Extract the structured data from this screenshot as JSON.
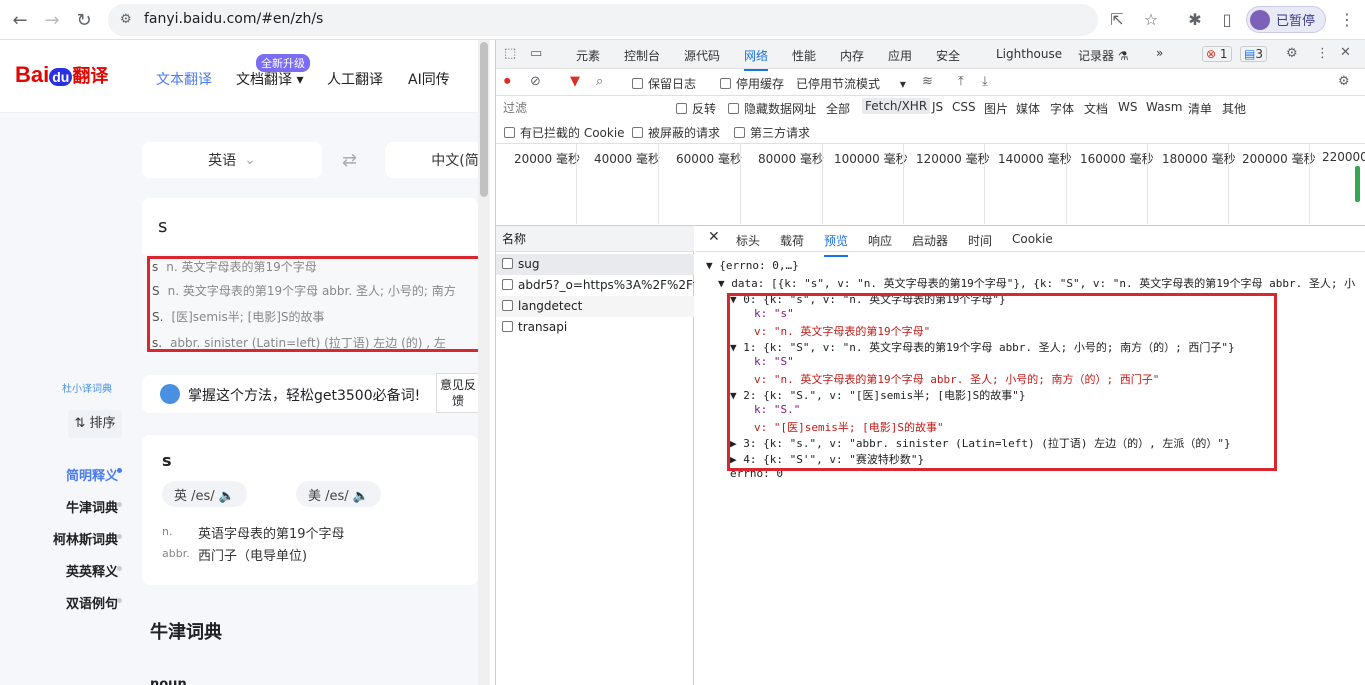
{
  "browser": {
    "url": "fanyi.baidu.com/#en/zh/s",
    "profile_label": "已暂停"
  },
  "site": {
    "logo_bai": "Bai",
    "logo_du": "du",
    "logo_fanyi": "翻译",
    "nav": [
      "文本翻译",
      "文档翻译 ▾",
      "人工翻译",
      "AI同传"
    ],
    "badge": "全新升级",
    "source_lang": "英语",
    "target_lang": "中文(简",
    "input_text": "s",
    "suggestions": [
      {
        "k": "s",
        "v": "n. 英文字母表的第19个字母"
      },
      {
        "k": "S",
        "v": "n. 英文字母表的第19个字母 abbr. 圣人; 小号的; 南方"
      },
      {
        "k": "S.",
        "v": "[医]semis半; [电影]S的故事"
      },
      {
        "k": "s.",
        "v": "abbr. sinister (Latin=left) (拉丁语) 左边 (的) , 左"
      }
    ],
    "tip_text": "掌握这个方法，轻松get3500必备词!",
    "tip_btn": "意见反馈",
    "dict_label": "杜小译词典",
    "sort_label": "⇅ 排序",
    "sidenav": [
      "简明释义",
      "牛津词典",
      "柯林斯词典",
      "英英释义",
      "双语例句"
    ],
    "result": {
      "word": "s",
      "pron_uk": "英 /es/ 🔈",
      "pron_us": "美 /es/ 🔈",
      "defs": [
        {
          "pos": "n.",
          "text": "英语字母表的第19个字母"
        },
        {
          "pos": "abbr.",
          "text": "西门子（电导单位)"
        }
      ]
    },
    "oxford_title": "牛津词典",
    "noun_label": "noun"
  },
  "devtools": {
    "tabs": [
      "元素",
      "控制台",
      "源代码",
      "网络",
      "性能",
      "内存",
      "应用",
      "安全",
      "Lighthouse",
      "记录器 ⚗",
      "»"
    ],
    "active_tab": "网络",
    "errors": "1",
    "messages": "3",
    "toolbar": {
      "preserve_log": "保留日志",
      "disable_cache": "停用缓存",
      "throttle": "已停用节流模式"
    },
    "filter": {
      "placeholder": "过滤",
      "invert": "反转",
      "hide_data": "隐藏数据网址",
      "types": [
        "全部",
        "Fetch/XHR",
        "JS",
        "CSS",
        "图片",
        "媒体",
        "字体",
        "文档",
        "WS",
        "Wasm",
        "清单",
        "其他"
      ]
    },
    "filter2": {
      "blocked_cookie": "有已拦截的 Cookie",
      "blocked_req": "被屏蔽的请求",
      "third_party": "第三方请求"
    },
    "timeline": [
      "20000 毫秒",
      "40000 毫秒",
      "60000 毫秒",
      "80000 毫秒",
      "100000 毫秒",
      "120000 毫秒",
      "140000 毫秒",
      "160000 毫秒",
      "180000 毫秒",
      "200000 毫秒",
      "220000"
    ],
    "name_header": "名称",
    "requests": [
      "sug",
      "abdr5?_o=https%3A%2F%2Ff...",
      "langdetect",
      "transapi"
    ],
    "preview_tabs": [
      "标头",
      "载荷",
      "预览",
      "响应",
      "启动器",
      "时间",
      "Cookie"
    ],
    "json_lines": [
      "▼ {errno: 0,…}",
      "▼ data: [{k: \"s\", v: \"n. 英文字母表的第19个字母\"}, {k: \"S\", v: \"n. 英文字母表的第19个字母 abbr. 圣人; 小",
      "▼ 0: {k: \"s\", v: \"n. 英文字母表的第19个字母\"}",
      "k: \"s\"",
      "v: \"n. 英文字母表的第19个字母\"",
      "▼ 1: {k: \"S\", v: \"n. 英文字母表的第19个字母 abbr. 圣人; 小号的; 南方（的）; 西门子\"}",
      "k: \"S\"",
      "v: \"n. 英文字母表的第19个字母 abbr.  圣人; 小号的; 南方（的）; 西门子\"",
      "▼ 2: {k: \"S.\", v: \"[医]semis半; [电影]S的故事\"}",
      "k: \"S.\"",
      "v: \"[医]semis半; [电影]S的故事\"",
      "▶ 3: {k: \"s.\", v: \"abbr. sinister (Latin=left) (拉丁语) 左边（的）, 左派（的）\"}",
      "▶ 4: {k: \"S'\", v: \"赛波特秒数\"}",
      "errno: 0"
    ]
  }
}
